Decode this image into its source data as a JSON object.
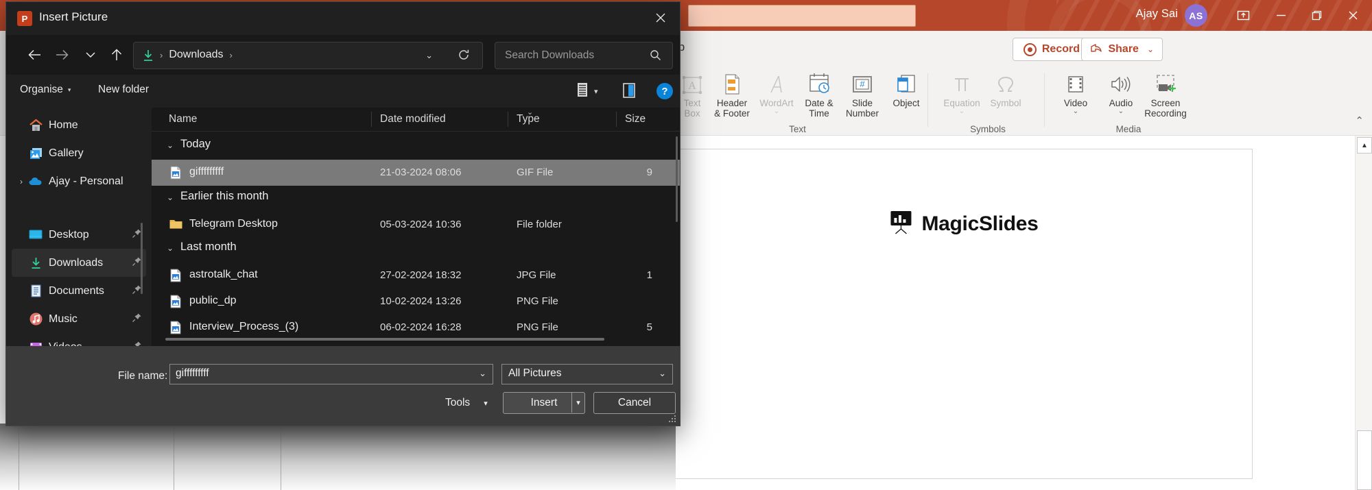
{
  "powerpoint": {
    "titlebar": {
      "user_name": "Ajay Sai",
      "avatar_initials": "AS",
      "ribbon_display_icon": "ribbon-display-options-icon",
      "minimize_icon": "minimize-icon",
      "restore_icon": "restore-icon",
      "close_icon": "close-icon",
      "accent_color": "#b7472a"
    },
    "ribbon_bar": {
      "help_tab": "lp",
      "record_label": "Record",
      "share_label": "Share",
      "share_chevron": "⌄"
    },
    "ribbon": {
      "groups": [
        {
          "label": "Text",
          "items": [
            {
              "label_line1": "Text",
              "label_line2": "Box",
              "icon": "text-box-icon",
              "disabled": true
            },
            {
              "label_line1": "Header",
              "label_line2": "& Footer",
              "icon": "header-footer-icon",
              "disabled": false
            },
            {
              "label_line1": "WordArt",
              "label_line2": "",
              "icon": "wordart-icon",
              "disabled": true,
              "caret": "⌄"
            },
            {
              "label_line1": "Date &",
              "label_line2": "Time",
              "icon": "date-time-icon",
              "disabled": false
            },
            {
              "label_line1": "Slide",
              "label_line2": "Number",
              "icon": "slide-number-icon",
              "disabled": false
            },
            {
              "label_line1": "Object",
              "label_line2": "",
              "icon": "object-icon",
              "disabled": false
            }
          ]
        },
        {
          "label": "Symbols",
          "items": [
            {
              "label_line1": "Equation",
              "label_line2": "",
              "icon": "equation-pi-icon",
              "disabled": true,
              "caret": "⌄"
            },
            {
              "label_line1": "Symbol",
              "label_line2": "",
              "icon": "symbol-omega-icon",
              "disabled": true
            }
          ]
        },
        {
          "label": "Media",
          "items": [
            {
              "label_line1": "Video",
              "label_line2": "",
              "icon": "video-icon",
              "disabled": false,
              "caret": "⌄"
            },
            {
              "label_line1": "Audio",
              "label_line2": "",
              "icon": "audio-speaker-icon",
              "disabled": false,
              "caret": "⌄"
            },
            {
              "label_line1": "Screen",
              "label_line2": "Recording",
              "icon": "screen-recording-icon",
              "disabled": false
            }
          ]
        }
      ],
      "collapse_chevron": "⌃"
    },
    "slide": {
      "logo_text": "MagicSlides",
      "logo_icon": "magicslides-easel-icon"
    },
    "scrollbar": {
      "up_arrow": "▲"
    }
  },
  "dialog": {
    "title": "Insert Picture",
    "app_icon_letter": "P",
    "close_icon": "close-icon",
    "nav": {
      "back_icon": "back-arrow-icon",
      "forward_icon": "forward-arrow-icon",
      "recent_icon": "recent-locations-chevron-icon",
      "up_icon": "up-arrow-icon"
    },
    "address": {
      "location_icon": "downloads-icon",
      "crumbs": [
        "Downloads"
      ],
      "separator": "›",
      "leading_separator": "›",
      "dropdown_chevron": "⌄",
      "refresh_icon": "refresh-icon"
    },
    "search": {
      "placeholder": "Search Downloads",
      "icon": "search-icon"
    },
    "toolbar": {
      "organise_label": "Organise",
      "organise_caret": "▾",
      "new_folder_label": "New folder",
      "view_icon": "view-list-icon",
      "view_caret": "▾",
      "layout_pane_icon": "preview-pane-icon",
      "help_icon": "help-icon",
      "help_letter": "?"
    },
    "sidebar": {
      "items": [
        {
          "label": "Home",
          "icon": "home-icon",
          "pinned": false,
          "expandable": false,
          "selected": false
        },
        {
          "label": "Gallery",
          "icon": "gallery-icon",
          "pinned": false,
          "expandable": false,
          "selected": false
        },
        {
          "label": "Ajay - Personal",
          "icon": "onedrive-cloud-icon",
          "pinned": false,
          "expandable": true,
          "expand_chevron": "›",
          "selected": false
        },
        {
          "label": "Desktop",
          "icon": "desktop-icon",
          "pinned": true,
          "expandable": false,
          "selected": false
        },
        {
          "label": "Downloads",
          "icon": "downloads-icon",
          "pinned": true,
          "expandable": false,
          "selected": true
        },
        {
          "label": "Documents",
          "icon": "documents-icon",
          "pinned": true,
          "expandable": false,
          "selected": false
        },
        {
          "label": "Music",
          "icon": "music-icon",
          "pinned": true,
          "expandable": false,
          "selected": false
        },
        {
          "label": "Videos",
          "icon": "videos-icon",
          "pinned": true,
          "expandable": false,
          "selected": false
        }
      ],
      "pin_icon": "pin-icon"
    },
    "filelist": {
      "columns": [
        "Name",
        "Date modified",
        "Type",
        "Size"
      ],
      "sort_indicator": "⌄",
      "group_chevron": "⌄",
      "groups": [
        {
          "label": "Today",
          "rows": [
            {
              "name": "gifffffffff",
              "date": "21-03-2024 08:06",
              "type": "GIF File",
              "size": "9",
              "icon": "image-file-icon",
              "selected": true
            }
          ]
        },
        {
          "label": "Earlier this month",
          "rows": [
            {
              "name": "Telegram Desktop",
              "date": "05-03-2024 10:36",
              "type": "File folder",
              "size": "",
              "icon": "folder-icon",
              "selected": false
            }
          ]
        },
        {
          "label": "Last month",
          "rows": [
            {
              "name": "astrotalk_chat",
              "date": "27-02-2024 18:32",
              "type": "JPG File",
              "size": "1",
              "icon": "image-file-icon",
              "selected": false
            },
            {
              "name": "public_dp",
              "date": "10-02-2024 13:26",
              "type": "PNG File",
              "size": "",
              "icon": "image-file-icon",
              "selected": false
            },
            {
              "name": "Interview_Process_(3)",
              "date": "06-02-2024 16:28",
              "type": "PNG File",
              "size": "5",
              "icon": "image-file-icon",
              "selected": false
            }
          ]
        }
      ]
    },
    "footer": {
      "filename_label": "File name:",
      "filename_value": "gifffffffff",
      "filename_chevron": "⌄",
      "filter_value": "All Pictures",
      "filter_chevron": "⌄",
      "tools_label": "Tools",
      "tools_caret": "▾",
      "insert_label": "Insert",
      "insert_split_caret": "▾",
      "cancel_label": "Cancel"
    }
  }
}
